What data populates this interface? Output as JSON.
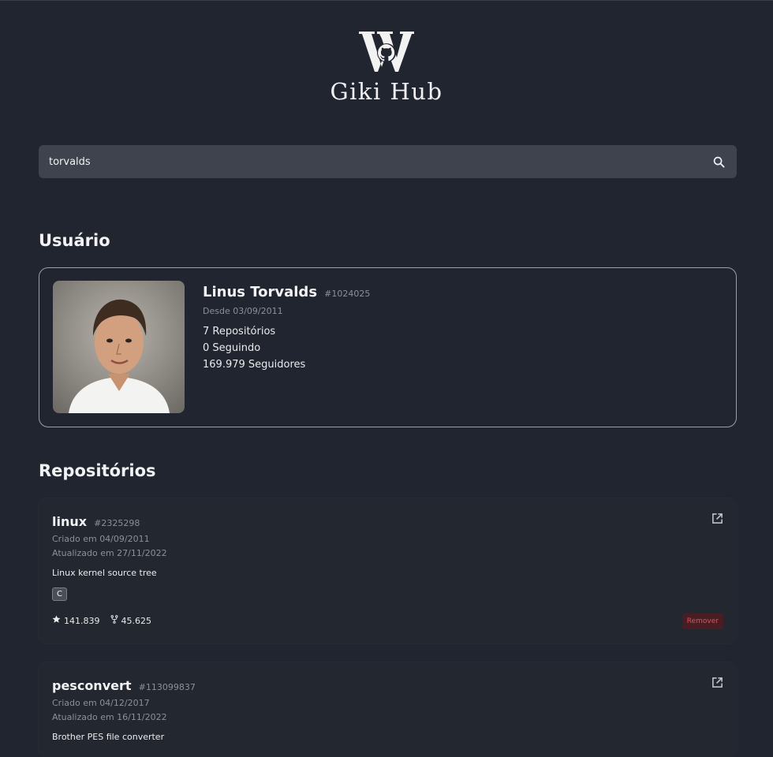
{
  "header": {
    "title": "Giki Hub",
    "logo_icon": "giki-hub-logo-icon"
  },
  "search": {
    "value": "torvalds",
    "icon": "search-icon"
  },
  "user_section": {
    "title": "Usuário",
    "name": "Linus Torvalds",
    "id": "#1024025",
    "since": "Desde 03/09/2011",
    "repos": "7 Repositórios",
    "following": "0 Seguindo",
    "followers": "169.979 Seguidores"
  },
  "repos_section": {
    "title": "Repositórios",
    "items": [
      {
        "name": "linux",
        "id": "#2325298",
        "created": "Criado em 04/09/2011",
        "updated": "Atualizado em 27/11/2022",
        "description": "Linux kernel source tree",
        "language": "C",
        "stars": "141.839",
        "forks": "45.625",
        "remove_label": "Remover"
      },
      {
        "name": "pesconvert",
        "id": "#113099837",
        "created": "Criado em 04/12/2017",
        "updated": "Atualizado em 16/11/2022",
        "description": "Brother PES file converter"
      }
    ]
  },
  "colors": {
    "background": "#212530",
    "remove_text": "#d9545f",
    "remove_bg": "#4a1d22"
  }
}
